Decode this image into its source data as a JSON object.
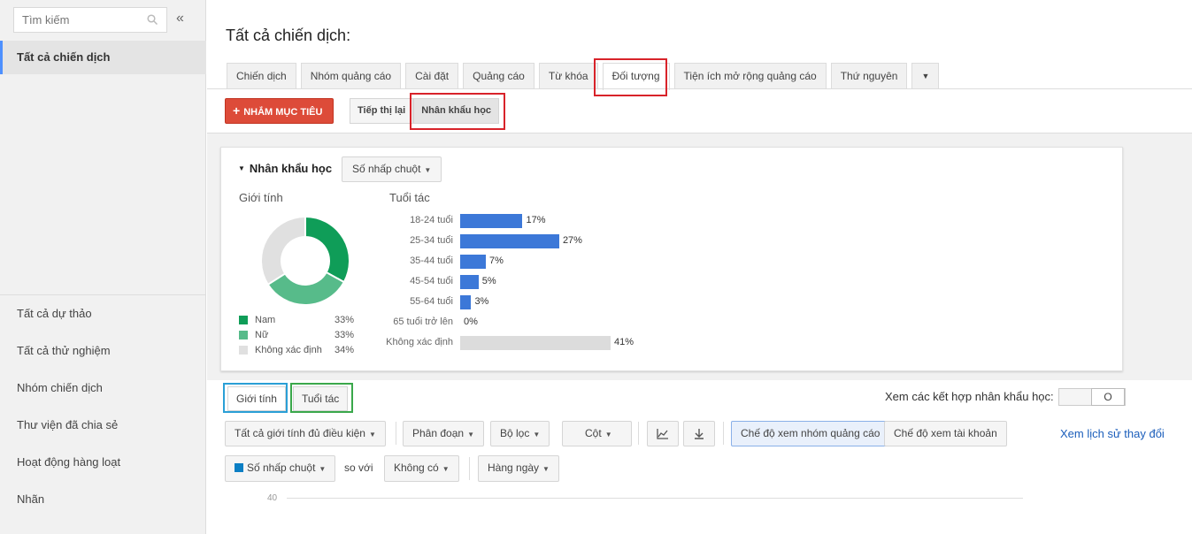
{
  "sidebar": {
    "search_placeholder": "Tìm kiếm",
    "collapse_symbol": "«",
    "selected_item": "Tất cả chiến dịch",
    "items": [
      {
        "label": "Tất cả dự thảo"
      },
      {
        "label": "Tất cả thử nghiệm"
      },
      {
        "label": "Nhóm chiến dịch"
      },
      {
        "label": "Thư viện đã chia sẻ"
      },
      {
        "label": "Hoạt động hàng loạt"
      },
      {
        "label": "Nhãn"
      }
    ]
  },
  "page_title": "Tất cả chiến dịch:",
  "tabs": [
    {
      "label": "Chiến dịch"
    },
    {
      "label": "Nhóm quảng cáo"
    },
    {
      "label": "Cài đặt"
    },
    {
      "label": "Quảng cáo"
    },
    {
      "label": "Từ khóa"
    },
    {
      "label": "Đối tượng",
      "active": true
    },
    {
      "label": "Tiện ích mở rộng quảng cáo"
    },
    {
      "label": "Thứ nguyên"
    },
    {
      "label": "▼",
      "icon": "dropdown-arrow-icon"
    }
  ],
  "toolbar": {
    "target_button": "NHẮM MỤC TIÊU",
    "subtabs": [
      {
        "label": "Tiếp thị lại"
      },
      {
        "label": "Nhân khẩu học",
        "selected": true
      }
    ]
  },
  "demographics": {
    "title": "Nhân khẩu học",
    "metric_dropdown": "Số nhấp chuột",
    "gender_label": "Giới tính",
    "age_label": "Tuổi tác",
    "gender_legend": [
      {
        "label": "Nam",
        "value": "33%",
        "color": "#0f9d58"
      },
      {
        "label": "Nữ",
        "value": "33%",
        "color": "#57bb8a"
      },
      {
        "label": "Không xác định",
        "value": "34%",
        "color": "#e0e0e0"
      }
    ]
  },
  "chart_data": {
    "type": "bar",
    "orientation": "horizontal",
    "title": "Tuổi tác",
    "categories": [
      "18-24 tuổi",
      "25-34 tuổi",
      "35-44 tuổi",
      "45-54 tuổi",
      "55-64 tuổi",
      "65 tuổi trở lên",
      "Không xác định"
    ],
    "values": [
      17,
      27,
      7,
      5,
      3,
      0,
      41
    ],
    "value_labels": [
      "17%",
      "27%",
      "7%",
      "5%",
      "3%",
      "0%",
      "41%"
    ],
    "colors": [
      "#3c78d8",
      "#3c78d8",
      "#3c78d8",
      "#3c78d8",
      "#3c78d8",
      "#3c78d8",
      "#dcdcdc"
    ]
  },
  "bottom_tabs": [
    {
      "label": "Giới tính",
      "selected": true
    },
    {
      "label": "Tuổi tác"
    }
  ],
  "combination_label": "Xem các kết hợp nhân khẩu học:",
  "toggle_state": "O",
  "filters": {
    "gender_filter": "Tất cả giới tính đủ điều kiện",
    "segment": "Phân đoạn",
    "filter": "Bộ lọc",
    "columns": "Cột",
    "adgroup_view": "Chế độ xem nhóm quảng cáo",
    "account_view": "Chế độ xem tài khoản",
    "history_link": "Xem lịch sử thay đổi",
    "metric": "Số nhấp chuột",
    "vs": "so với",
    "compare": "Không có",
    "period": "Hàng ngày",
    "metric_color": "#0b7fc4"
  },
  "perf_chart": {
    "y_tick": "40"
  }
}
